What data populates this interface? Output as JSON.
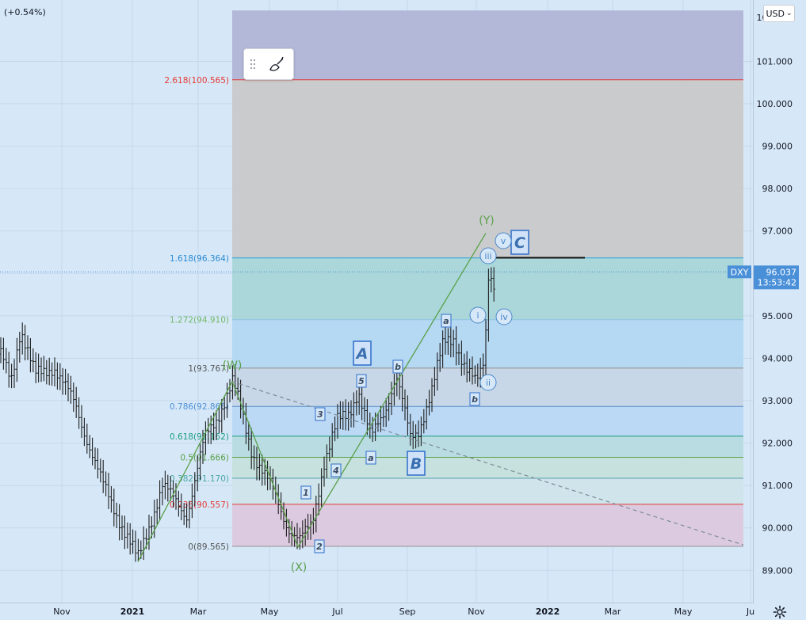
{
  "header": {
    "change_label": "(+0.54%)",
    "currency_label": "USD"
  },
  "toolbar": {
    "drag_handle_icon": "drag-dots-icon",
    "brush_icon": "brush-icon"
  },
  "settings": {
    "icon": "gear-icon"
  },
  "colors": {
    "background": "#d6e8f8",
    "bar": "#1e1e1e",
    "green": "#5aa04a",
    "wave_blue": "#2f6dc9",
    "symbol_badge": "#4a90d9",
    "red_line": "#e53935",
    "blue_line": "#2aa1d6",
    "teal_line": "#1c9c7d",
    "gray_fill": "#c8c8c8"
  },
  "chart_data": {
    "type": "ohlc",
    "symbol": "DXY",
    "last_price": "96.037",
    "countdown": "13:53:42",
    "y_axis": {
      "ticks": [
        "89.000",
        "90.000",
        "91.000",
        "92.000",
        "93.000",
        "94.000",
        "95.000",
        "96.000",
        "97.000",
        "98.000",
        "99.000",
        "100.000",
        "101.000"
      ],
      "top_partial": "102.000"
    },
    "x_axis": {
      "ticks": [
        "Nov",
        "2021",
        "Mar",
        "May",
        "Jul",
        "Sep",
        "Nov",
        "2022",
        "Mar",
        "May",
        "Ju"
      ]
    },
    "fib_levels": [
      {
        "label": "2.618(100.565)",
        "value": 100.565,
        "color": "#e53935",
        "label_color": "#e53935"
      },
      {
        "label": "1.618(96.364)",
        "value": 96.364,
        "color": "#2aa1d6",
        "label_color": "#2a8ad0"
      },
      {
        "label": "1.272(94.910)",
        "value": 94.91,
        "color": "#8ec3e6",
        "label_color": "#74b86a"
      },
      {
        "label": "1(93.767)",
        "value": 93.767,
        "color": "#8f8f8f",
        "label_color": "#555555"
      },
      {
        "label": "0.786(92.866)",
        "value": 92.866,
        "color": "#5b8fc9",
        "label_color": "#4d8fd6"
      },
      {
        "label": "0.618(92.162)",
        "value": 92.162,
        "color": "#1c9c7d",
        "label_color": "#1c9c7d"
      },
      {
        "label": "0.5(91.666)",
        "value": 91.666,
        "color": "#5aa04a",
        "label_color": "#5aa04a"
      },
      {
        "label": "0.382(91.170)",
        "value": 91.17,
        "color": "#5aa0b0",
        "label_color": "#4aa6a6"
      },
      {
        "label": "0.236(90.557)",
        "value": 90.557,
        "color": "#e53935",
        "label_color": "#e53935"
      },
      {
        "label": "0(89.565)",
        "value": 89.565,
        "color": "#8f8f8f",
        "label_color": "#555555"
      }
    ],
    "wave_labels": {
      "degree_green": [
        "(W)",
        "(X)",
        "(Y)"
      ],
      "boxed_large": [
        "A",
        "B",
        "C"
      ],
      "boxed_small": [
        "1",
        "2",
        "3",
        "4",
        "5",
        "a",
        "b",
        "a",
        "b"
      ],
      "circled": [
        "i",
        "ii",
        "iii",
        "iv",
        "v"
      ]
    }
  }
}
